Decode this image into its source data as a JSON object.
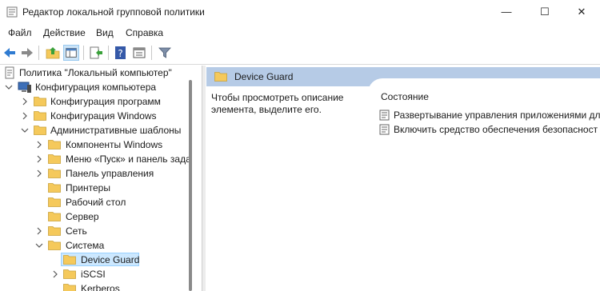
{
  "window": {
    "title": "Редактор локальной групповой политики",
    "minimize_glyph": "—",
    "maximize_glyph": "☐",
    "close_glyph": "✕"
  },
  "menu": [
    "Файл",
    "Действие",
    "Вид",
    "Справка"
  ],
  "toolbar": {
    "buttons": [
      "back-icon",
      "forward-icon",
      "up-folder-icon",
      "show-hide-tree-icon",
      "export-list-icon",
      "help-icon",
      "properties-icon",
      "filter-icon"
    ]
  },
  "tree": {
    "root": "Политика \"Локальный компьютер\"",
    "computer_config": "Конфигурация компьютера",
    "software_settings": "Конфигурация программ",
    "windows_settings": "Конфигурация Windows",
    "admin_templates": "Административные шаблоны",
    "windows_components": "Компоненты Windows",
    "start_menu": "Меню «Пуск» и панель зада",
    "control_panel": "Панель управления",
    "printers": "Принтеры",
    "desktop": "Рабочий стол",
    "server": "Сервер",
    "network": "Сеть",
    "system": "Система",
    "device_guard": "Device Guard",
    "iscsi": "iSCSI",
    "kerberos": "Kerberos"
  },
  "right": {
    "header_title": "Device Guard",
    "description": "Чтобы просмотреть описание элемента, выделите его.",
    "column_header": "Состояние",
    "settings": [
      "Развертывание управления приложениями для",
      "Включить средство обеспечения безопасност"
    ]
  },
  "colors": {
    "header_blue": "#b6cbe6",
    "selection": "#cce8ff",
    "folder": "#f5c95b"
  }
}
